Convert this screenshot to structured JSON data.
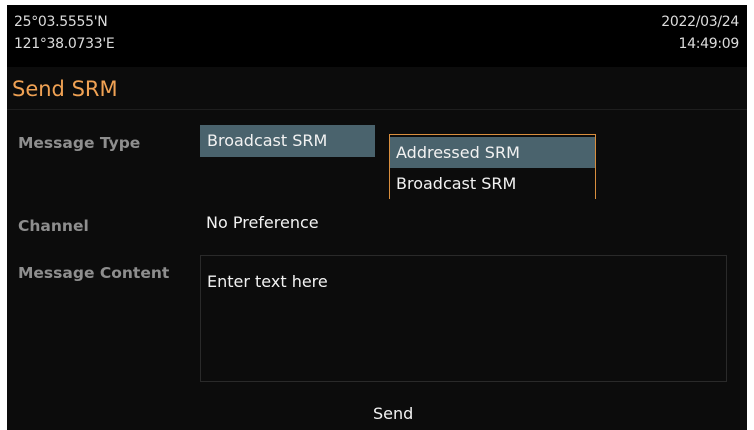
{
  "header": {
    "latitude": "25°03.5555'N",
    "longitude": "121°38.0733'E",
    "date": "2022/03/24",
    "time": "14:49:09"
  },
  "page": {
    "title": "Send SRM"
  },
  "form": {
    "message_type_label": "Message Type",
    "message_type_value": "Broadcast SRM",
    "message_type_options": [
      "Addressed SRM",
      "Broadcast SRM"
    ],
    "channel_label": "Channel",
    "channel_value": "No Preference",
    "message_content_label": "Message Content",
    "message_content_placeholder": "Enter text here",
    "send_label": "Send"
  },
  "colors": {
    "title": "#f0a254",
    "highlight": "#4a636d",
    "dropdown_border": "#d88e3e",
    "label": "#8e8e8e",
    "background": "#0c0c0c"
  }
}
